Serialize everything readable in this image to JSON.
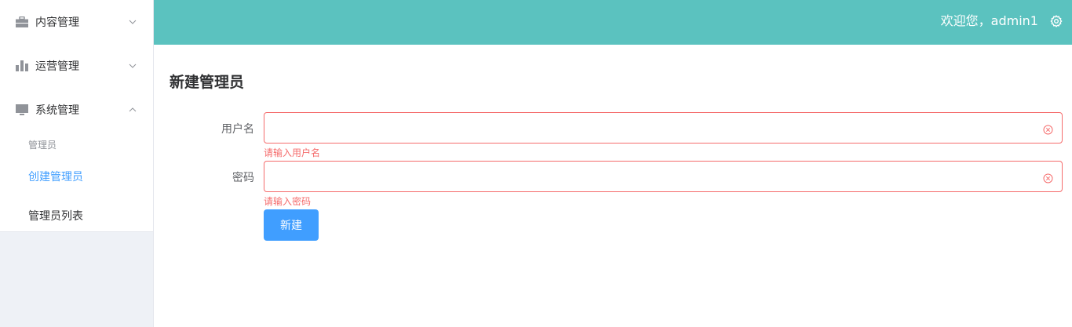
{
  "sidebar": {
    "menus": [
      {
        "label": "内容管理",
        "icon": "briefcase-icon"
      },
      {
        "label": "运营管理",
        "icon": "bar-chart-icon"
      },
      {
        "label": "系统管理",
        "icon": "monitor-icon"
      }
    ],
    "submenu_group_title": "管理员",
    "submenu_items": [
      {
        "label": "创建管理员",
        "active": true
      },
      {
        "label": "管理员列表",
        "active": false
      }
    ]
  },
  "header": {
    "welcome": "欢迎您，admin1",
    "settings_icon": "gear-icon"
  },
  "main": {
    "title": "新建管理员",
    "form": {
      "username": {
        "label": "用户名",
        "value": "",
        "error": "请输入用户名"
      },
      "password": {
        "label": "密码",
        "value": "",
        "error": "请输入密码"
      },
      "submit_label": "新建"
    }
  },
  "colors": {
    "header_bg": "#5bc2bf",
    "active_link": "#409eff",
    "error": "#f56c6c",
    "primary_button": "#409eff"
  }
}
